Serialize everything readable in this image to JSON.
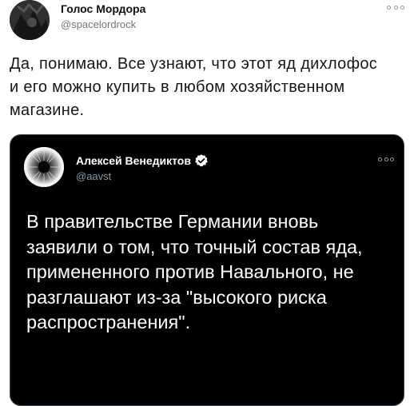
{
  "tweet": {
    "author_name": "Голос Мордора",
    "author_handle": "@spacelordrock",
    "more_icon": "more-icon",
    "text": "Да, понимаю. Все узнают, что этот яд дихлофос и его можно купить в любом хозяйственном магазине."
  },
  "quoted_tweet": {
    "author_name": "Алексей Венедиктов",
    "verified_icon": "verified-badge-icon",
    "author_handle": "@aavst",
    "more_icon": "more-icon",
    "text": "В правительстве Германии вновь заявили о том, что точный состав яда, примененного против Навального, не разглашают из-за \"высокого риска распространения\"."
  },
  "colors": {
    "card_background": "#000000",
    "card_border": "#38444d",
    "verified_blue": "#1d9bf0",
    "secondary_text": "#8b98a5"
  }
}
